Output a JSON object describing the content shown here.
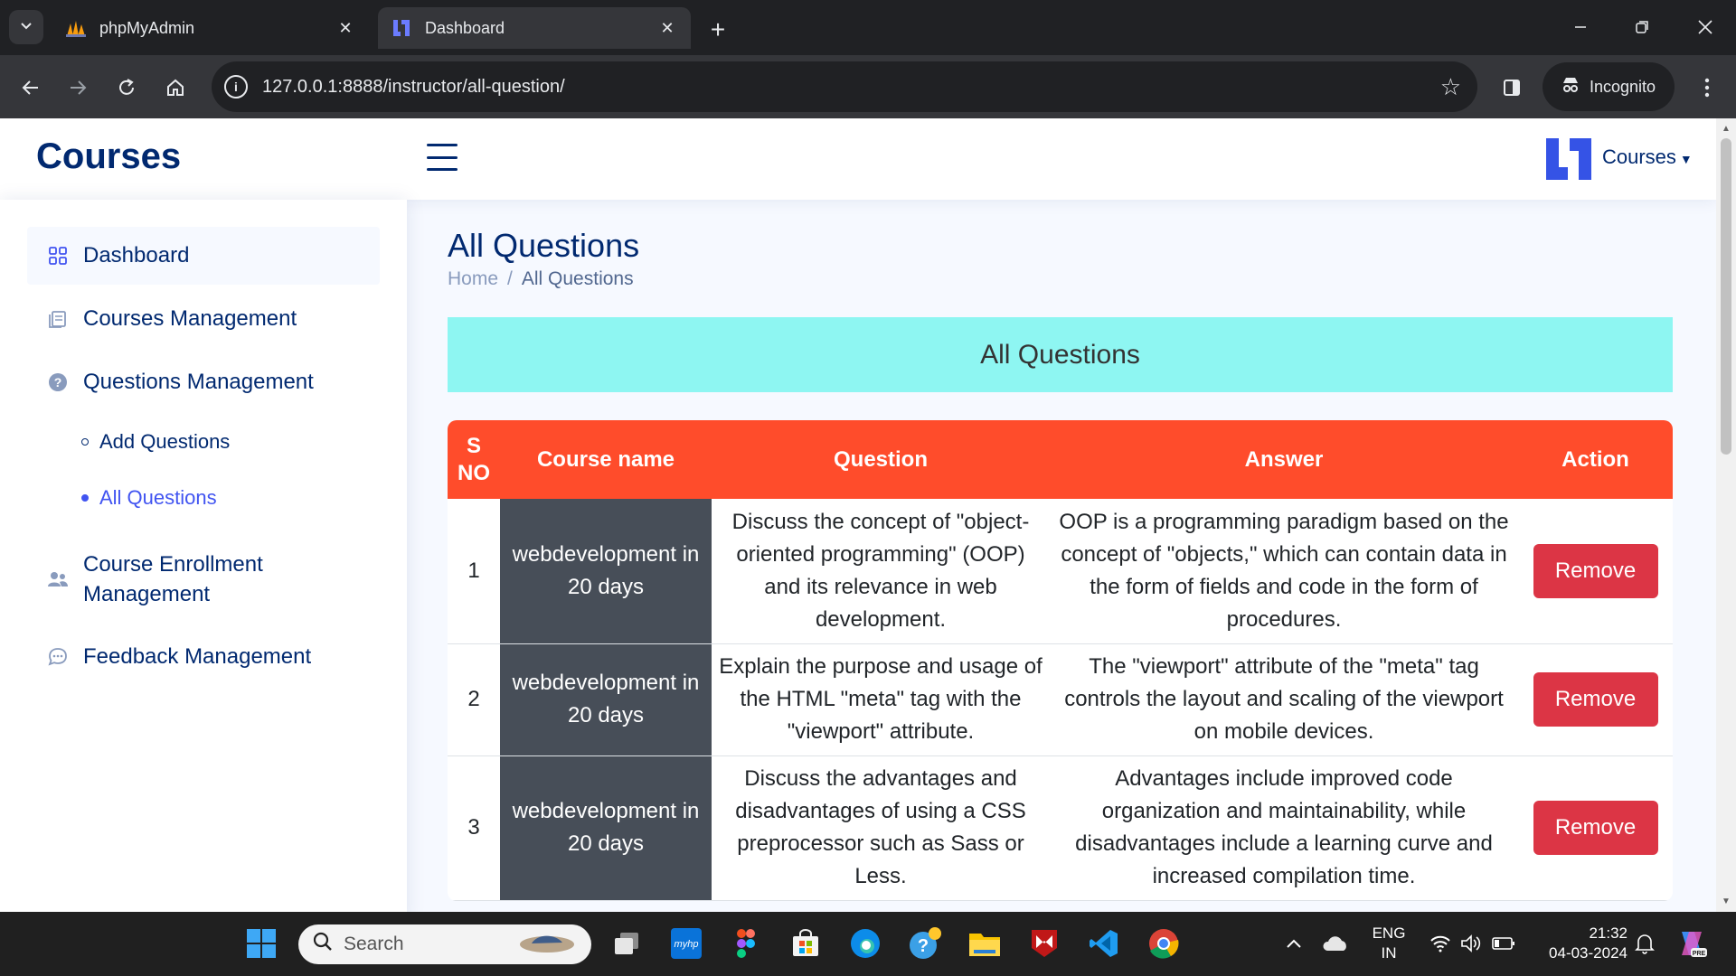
{
  "browser": {
    "tabs": [
      {
        "title": "phpMyAdmin",
        "active": false
      },
      {
        "title": "Dashboard",
        "active": true
      }
    ],
    "url": "127.0.0.1:8888/instructor/all-question/",
    "incognito_label": "Incognito"
  },
  "header": {
    "brand": "Courses",
    "user_label": "Courses"
  },
  "sidebar": {
    "items": [
      {
        "label": "Dashboard",
        "icon": "grid-icon",
        "active": true
      },
      {
        "label": "Courses Management",
        "icon": "journal-icon"
      },
      {
        "label": "Questions Management",
        "icon": "question-circle-icon"
      },
      {
        "label": "Course Enrollment Management",
        "icon": "people-icon"
      },
      {
        "label": "Feedback Management",
        "icon": "chat-icon"
      }
    ],
    "sub_items": [
      {
        "label": "Add Questions",
        "active": false
      },
      {
        "label": "All Questions",
        "active": true
      }
    ]
  },
  "page": {
    "title": "All Questions",
    "breadcrumb": [
      "Home",
      "All Questions"
    ],
    "banner": "All Questions"
  },
  "table": {
    "headers": [
      "S NO",
      "Course name",
      "Question",
      "Answer",
      "Action"
    ],
    "rows": [
      {
        "sno": "1",
        "course": "webdevelopment in 20 days",
        "question": "Discuss the concept of \"object-oriented programming\" (OOP) and its relevance in web development.",
        "answer": "OOP is a programming paradigm based on the concept of \"objects,\" which can contain data in the form of fields and code in the form of procedures.",
        "action": "Remove"
      },
      {
        "sno": "2",
        "course": "webdevelopment in 20 days",
        "question": "Explain the purpose and usage of the HTML \"meta\" tag with the \"viewport\" attribute.",
        "answer": "The \"viewport\" attribute of the \"meta\" tag controls the layout and scaling of the viewport on mobile devices.",
        "action": "Remove"
      },
      {
        "sno": "3",
        "course": "webdevelopment in 20 days",
        "question": "Discuss the advantages and disadvantages of using a CSS preprocessor such as Sass or Less.",
        "answer": "Advantages include improved code organization and maintainability, while disadvantages include a learning curve and increased compilation time.",
        "action": "Remove"
      }
    ]
  },
  "taskbar": {
    "search_placeholder": "Search",
    "lang": "ENG",
    "region": "IN",
    "time": "21:32",
    "date": "04-03-2024"
  }
}
